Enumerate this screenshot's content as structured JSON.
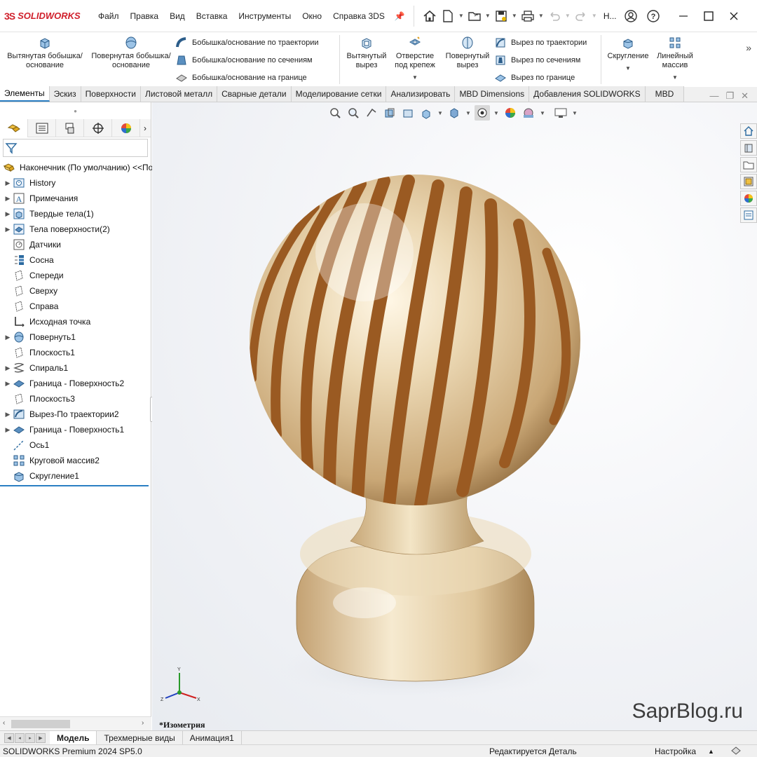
{
  "app": {
    "brand": "SOLIDWORKS",
    "logo_mark": "3S"
  },
  "menu": [
    "Файл",
    "Правка",
    "Вид",
    "Вставка",
    "Инструменты",
    "Окно",
    "Справка 3DS"
  ],
  "user_short": "Н...",
  "ribbon": {
    "extruded_boss": "Вытянутая бобышка/основание",
    "revolved_boss": "Повернутая бобышка/основание",
    "swept_boss": "Бобышка/основание по траектории",
    "lofted_boss": "Бобышка/основание по сечениям",
    "boundary_boss": "Бобышка/основание на границе",
    "extruded_cut": "Вытянутый вырез",
    "hole_wizard": "Отверстие под крепеж",
    "revolved_cut": "Повернутый вырез",
    "swept_cut": "Вырез по траектории",
    "lofted_cut": "Вырез по сечениям",
    "boundary_cut": "Вырез по границе",
    "fillet": "Скругление",
    "linear_pattern": "Линейный массив"
  },
  "tabs": [
    "Элементы",
    "Эскиз",
    "Поверхности",
    "Листовой металл",
    "Сварные детали",
    "Моделирование сетки",
    "Анализировать",
    "MBD Dimensions",
    "Добавления SOLIDWORKS",
    "MBD"
  ],
  "active_tab": "Элементы",
  "tree": {
    "root": "Наконечник (По умолчанию) <<По",
    "items": [
      {
        "label": "History",
        "icon": "history-icon",
        "expand": true
      },
      {
        "label": "Примечания",
        "icon": "annotations-icon",
        "expand": true
      },
      {
        "label": "Твердые тела(1)",
        "icon": "solid-bodies-icon",
        "expand": true
      },
      {
        "label": "Тела поверхности(2)",
        "icon": "surface-bodies-icon",
        "expand": true
      },
      {
        "label": "Датчики",
        "icon": "sensors-icon",
        "expand": false
      },
      {
        "label": "Сосна",
        "icon": "material-icon",
        "expand": false
      },
      {
        "label": "Спереди",
        "icon": "plane-icon",
        "expand": false
      },
      {
        "label": "Сверху",
        "icon": "plane-icon",
        "expand": false
      },
      {
        "label": "Справа",
        "icon": "plane-icon",
        "expand": false
      },
      {
        "label": "Исходная точка",
        "icon": "origin-icon",
        "expand": false
      },
      {
        "label": "Повернуть1",
        "icon": "revolve-icon",
        "expand": true
      },
      {
        "label": "Плоскость1",
        "icon": "plane-icon",
        "expand": false
      },
      {
        "label": "Спираль1",
        "icon": "helix-icon",
        "expand": true
      },
      {
        "label": "Граница - Поверхность2",
        "icon": "boundary-surface-icon",
        "expand": true
      },
      {
        "label": "Плоскость3",
        "icon": "plane-icon",
        "expand": false
      },
      {
        "label": "Вырез-По траектории2",
        "icon": "swept-cut-icon",
        "expand": true
      },
      {
        "label": "Граница - Поверхность1",
        "icon": "boundary-surface-icon",
        "expand": true
      },
      {
        "label": "Ось1",
        "icon": "axis-icon",
        "expand": false
      },
      {
        "label": "Круговой массив2",
        "icon": "circular-pattern-icon",
        "expand": false
      },
      {
        "label": "Скругление1",
        "icon": "fillet-icon",
        "expand": false
      }
    ]
  },
  "viewport": {
    "view_name": "*Изометрия",
    "watermark": "SaprBlog.ru",
    "triad": {
      "x": "X",
      "y": "Y",
      "z": "Z"
    }
  },
  "bottom_tabs": [
    "Модель",
    "Трехмерные виды",
    "Анимация1"
  ],
  "active_bottom_tab": "Модель",
  "status": {
    "version": "SOLIDWORKS Premium 2024 SP5.0",
    "mode": "Редактируется Деталь",
    "settings": "Настройка"
  },
  "colors": {
    "brand_red": "#d0202c",
    "accent_blue": "#2b7fc3",
    "wood_light": "#e8d6b4",
    "wood_groove": "#9a5a22"
  }
}
